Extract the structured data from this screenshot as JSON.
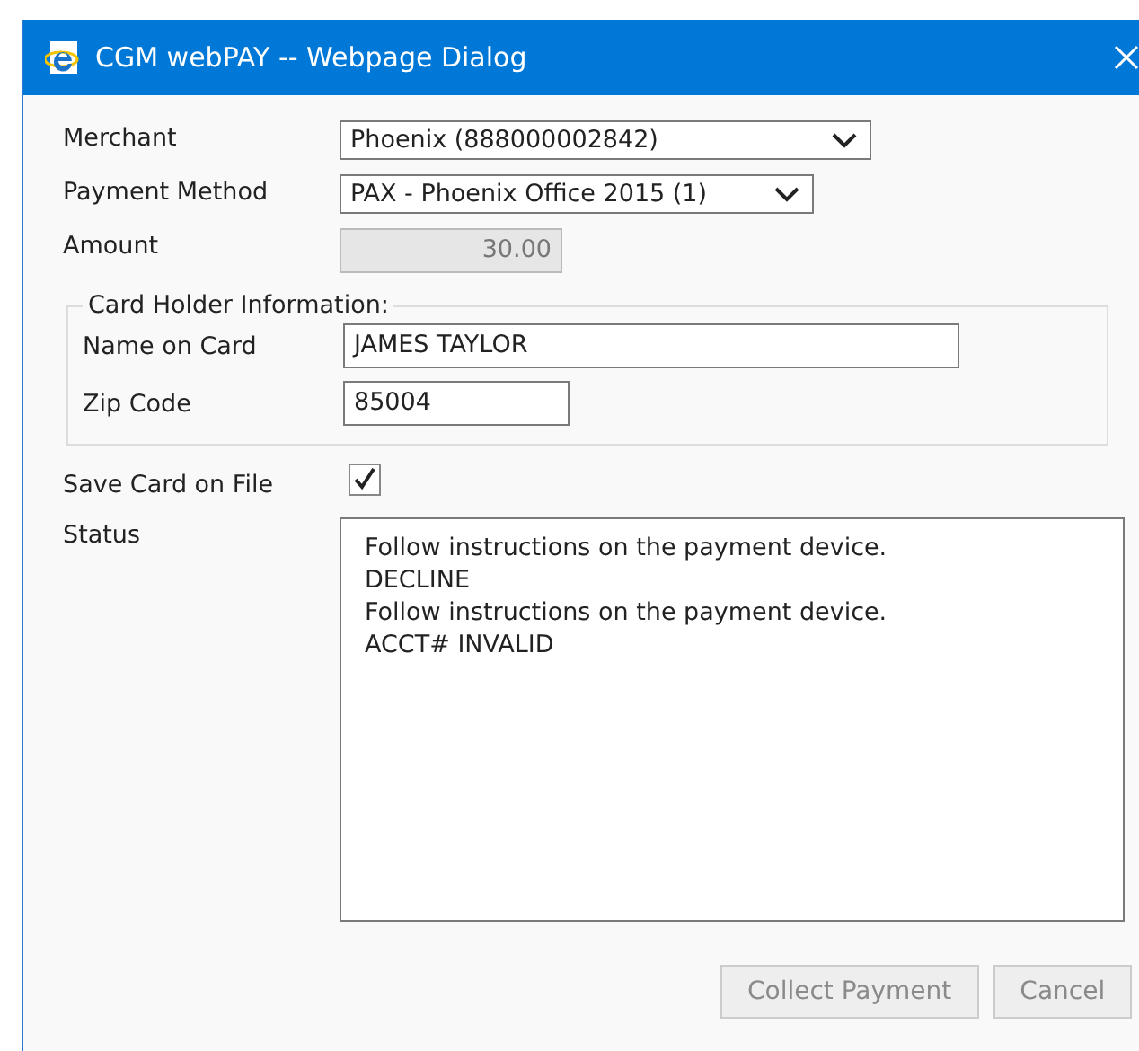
{
  "window": {
    "title": "CGM webPAY -- Webpage Dialog"
  },
  "form": {
    "merchant": {
      "label": "Merchant",
      "value": "Phoenix (888000002842)"
    },
    "payment_method": {
      "label": "Payment Method",
      "value": "PAX - Phoenix Office 2015 (1)"
    },
    "amount": {
      "label": "Amount",
      "value": "30.00",
      "disabled": true
    },
    "card_holder": {
      "legend": "Card Holder Information:",
      "name": {
        "label": "Name on Card",
        "value": "JAMES TAYLOR"
      },
      "zip": {
        "label": "Zip Code",
        "value": "85004"
      }
    },
    "save_card": {
      "label": "Save Card on File",
      "checked": true
    },
    "status": {
      "label": "Status",
      "lines": [
        "Follow instructions on the payment device.",
        "DECLINE",
        "Follow instructions on the payment device.",
        "ACCT# INVALID"
      ]
    }
  },
  "buttons": [
    {
      "label": "Collect Payment",
      "disabled": true
    },
    {
      "label": "Cancel",
      "disabled": true
    }
  ]
}
